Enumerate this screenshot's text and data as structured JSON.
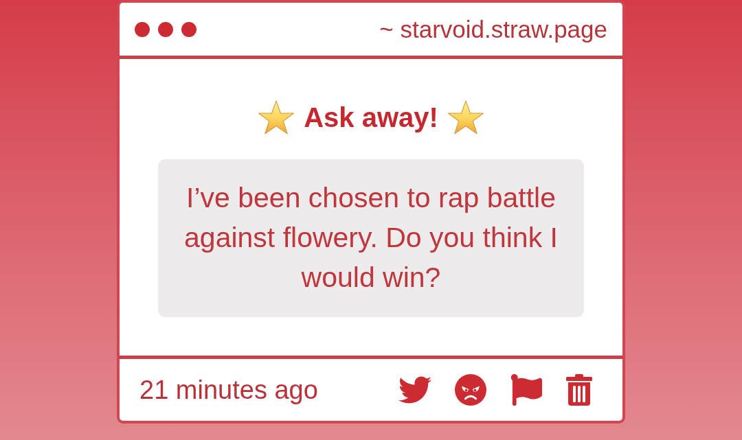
{
  "window": {
    "address": "~ starvoid.straw.page"
  },
  "prompt": {
    "title": "Ask away!",
    "question": "I’ve been chosen to rap battle against flowery. Do you think I would win?"
  },
  "footer": {
    "timestamp": "21 minutes ago"
  }
}
